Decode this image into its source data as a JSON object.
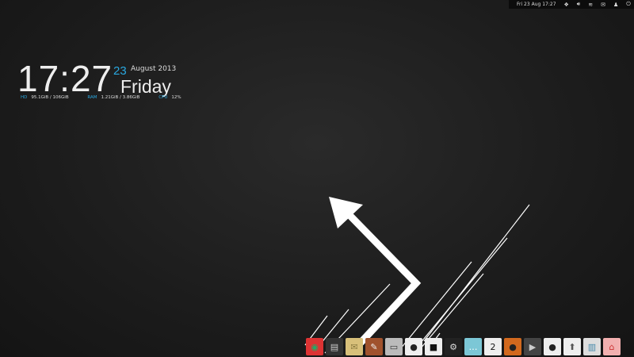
{
  "topbar": {
    "datetime": "Fri 23 Aug 17:27",
    "icons": [
      "dropbox-icon",
      "volume-icon",
      "wifi-icon",
      "mail-icon",
      "user-icon",
      "power-icon"
    ]
  },
  "clock": {
    "time": "17:27",
    "day": "23",
    "month_year": "August 2013",
    "weekday": "Friday",
    "stats": [
      {
        "label": "HD",
        "value": "95.1GiB / 106GiB"
      },
      {
        "label": "RAM",
        "value": "1.21GiB / 3.86GiB"
      },
      {
        "label": "CPU",
        "value": "12%"
      }
    ]
  },
  "dock": {
    "apps": [
      {
        "name": "chrome",
        "bg": "#d33",
        "glyph": "◉",
        "fg": "#2a6"
      },
      {
        "name": "file-cabinet",
        "bg": "#333",
        "glyph": "▤",
        "fg": "#ccc"
      },
      {
        "name": "mail",
        "bg": "#d8c07a",
        "glyph": "✉",
        "fg": "#8a7a40"
      },
      {
        "name": "notes",
        "bg": "#a0522d",
        "glyph": "✎",
        "fg": "#eee"
      },
      {
        "name": "terminal",
        "bg": "#bbb",
        "glyph": "▭",
        "fg": "#333"
      },
      {
        "name": "camera",
        "bg": "#eee",
        "glyph": "●",
        "fg": "#222"
      },
      {
        "name": "document",
        "bg": "#eee",
        "glyph": "■",
        "fg": "#111"
      },
      {
        "name": "steam",
        "bg": "#222",
        "glyph": "⚙",
        "fg": "#ddd"
      },
      {
        "name": "chat",
        "bg": "#7cc7d6",
        "glyph": "…",
        "fg": "#fff"
      },
      {
        "name": "calendar",
        "bg": "#eee",
        "glyph": "2",
        "fg": "#111"
      },
      {
        "name": "music",
        "bg": "#d2691e",
        "glyph": "●",
        "fg": "#222"
      },
      {
        "name": "media-player",
        "bg": "#444",
        "glyph": "▶",
        "fg": "#ccc"
      },
      {
        "name": "webcam",
        "bg": "#eee",
        "glyph": "●",
        "fg": "#222"
      },
      {
        "name": "updater",
        "bg": "#eee",
        "glyph": "⬆",
        "fg": "#555"
      },
      {
        "name": "workspaces",
        "bg": "#ddd",
        "glyph": "▥",
        "fg": "#48a"
      },
      {
        "name": "store",
        "bg": "#f2b0b0",
        "glyph": "⌂",
        "fg": "#c33"
      }
    ]
  }
}
